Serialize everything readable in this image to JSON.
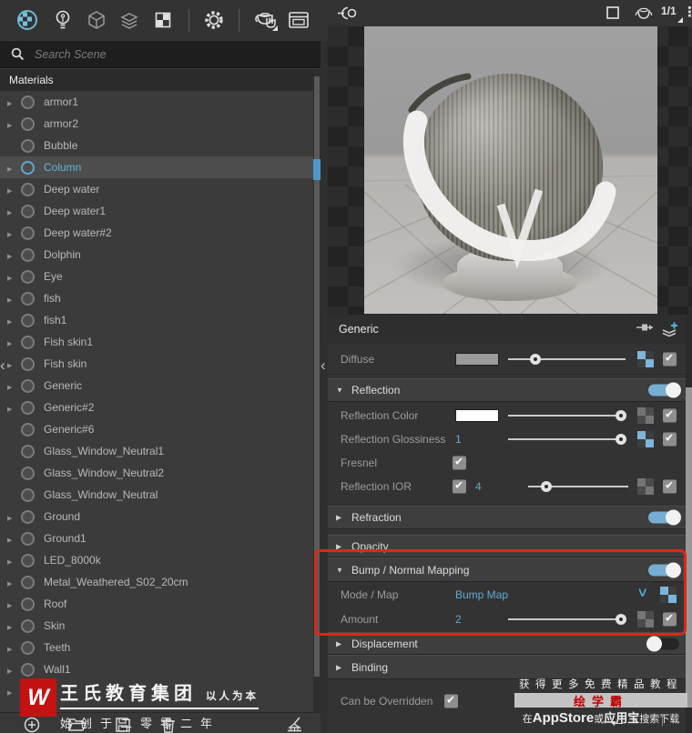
{
  "toolbar": {
    "icons": [
      "materials",
      "lights",
      "geometry",
      "layers",
      "textures",
      "settings",
      "render-interactive",
      "frame-buffer"
    ]
  },
  "search": {
    "placeholder": "Search Scene"
  },
  "materials_list": {
    "header": "Materials",
    "items": [
      {
        "label": "armor1",
        "expandable": true
      },
      {
        "label": "armor2",
        "expandable": true
      },
      {
        "label": "Bubble",
        "expandable": false
      },
      {
        "label": "Column",
        "expandable": true,
        "selected": true
      },
      {
        "label": "Deep water",
        "expandable": true
      },
      {
        "label": "Deep water1",
        "expandable": true
      },
      {
        "label": "Deep water#2",
        "expandable": true
      },
      {
        "label": "Dolphin",
        "expandable": true
      },
      {
        "label": "Eye",
        "expandable": true
      },
      {
        "label": "fish",
        "expandable": true
      },
      {
        "label": "fish1",
        "expandable": true
      },
      {
        "label": "Fish skin1",
        "expandable": true
      },
      {
        "label": "Fish skin",
        "expandable": true
      },
      {
        "label": "Generic",
        "expandable": true
      },
      {
        "label": "Generic#2",
        "expandable": true
      },
      {
        "label": "Generic#6",
        "expandable": false
      },
      {
        "label": "Glass_Window_Neutral1",
        "expandable": false
      },
      {
        "label": "Glass_Window_Neutral2",
        "expandable": false
      },
      {
        "label": "Glass_Window_Neutral",
        "expandable": false
      },
      {
        "label": "Ground",
        "expandable": true
      },
      {
        "label": "Ground1",
        "expandable": true
      },
      {
        "label": "LED_8000k",
        "expandable": true
      },
      {
        "label": "Metal_Weathered_S02_20cm",
        "expandable": true
      },
      {
        "label": "Roof",
        "expandable": true
      },
      {
        "label": "Skin",
        "expandable": true
      },
      {
        "label": "Teeth",
        "expandable": true
      },
      {
        "label": "Wall1",
        "expandable": true
      },
      {
        "label": "",
        "expandable": true
      }
    ]
  },
  "preview": {
    "page_indicator": "1/1"
  },
  "properties": {
    "material_type": "Generic",
    "diffuse": {
      "label": "Diffuse",
      "swatch": "#9b9b9b",
      "slider_pct": 23,
      "has_map": true,
      "checked": true
    },
    "reflection": {
      "label": "Reflection",
      "enabled": true
    },
    "reflection_color": {
      "label": "Reflection Color",
      "swatch": "#ffffff",
      "slider_pct": 96,
      "has_map": false,
      "checked": true
    },
    "reflection_glossiness": {
      "label": "Reflection Glossiness",
      "value": "1",
      "slider_pct": 96,
      "has_map": true,
      "checked": true
    },
    "fresnel": {
      "label": "Fresnel",
      "checked": true
    },
    "reflection_ior": {
      "label": "Reflection IOR",
      "enabled_check": true,
      "value": "4",
      "slider_pct": 18,
      "has_map": false,
      "checked": true
    },
    "refraction": {
      "label": "Refraction",
      "enabled": true
    },
    "opacity": {
      "label": "Opacity"
    },
    "bump": {
      "label": "Bump / Normal Mapping",
      "enabled": true
    },
    "mode_map": {
      "label": "Mode / Map",
      "value": "Bump Map",
      "has_map": true
    },
    "amount": {
      "label": "Amount",
      "value": "2",
      "slider_pct": 96,
      "has_map": false,
      "checked": true
    },
    "displacement": {
      "label": "Displacement",
      "enabled": false
    },
    "binding": {
      "label": "Binding"
    },
    "overridden": {
      "label": "Can be Overridden",
      "checked": true
    }
  },
  "colors": {
    "accent_blue": "#64a8d1",
    "toggle_on": "#76aed3",
    "annotation_red": "#e02616",
    "selected_item_text": "#66b3de"
  },
  "watermarks": {
    "left": {
      "logo_letter": "W",
      "brand": "王氏教育集团",
      "tagline": "以人为本",
      "subtitle": "始创于二零零二年"
    },
    "right": {
      "line1": "获得更多免费精品教程",
      "brand": "绘学霸",
      "line3_pre": "在",
      "line3_store": "AppStore",
      "line3_mid": "或",
      "line3_store2": "应用宝",
      "line3_post": "搜索下载",
      "arrow_left": "←",
      "arrow_up": "↑"
    }
  }
}
